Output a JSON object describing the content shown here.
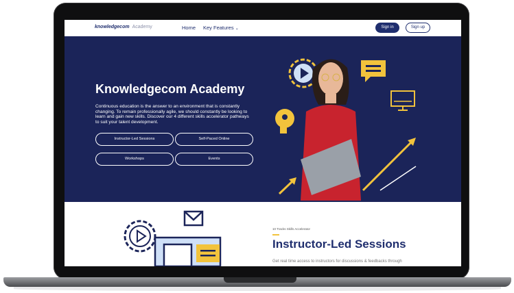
{
  "nav": {
    "logo": "knowledgecom",
    "logo_sub": "Academy",
    "home": "Home",
    "key_features": "Key Features",
    "sign_in": "Sign in",
    "sign_up": "Sign up"
  },
  "hero": {
    "title": "Knowledgecom Academy",
    "description": "Continuous education is the answer to an environment that is constantly changing. To remain professionally agile, we should constantly be looking to learn and gain new skills. Discover our 4 different skills accelerator pathways to suit your talent development.",
    "buttons": [
      "Instructor-Led Sessions",
      "Self-Paced Online",
      "Workshops",
      "Events"
    ]
  },
  "section": {
    "eyebrow": "10 Tracks Skills Accelerator",
    "title": "Instructor-Led Sessions",
    "description": "Get real time access to instructors for discussions & feedbacks through"
  },
  "colors": {
    "navy": "#1b2459",
    "accent": "#f2c33c",
    "brand": "#1f2e6e"
  }
}
